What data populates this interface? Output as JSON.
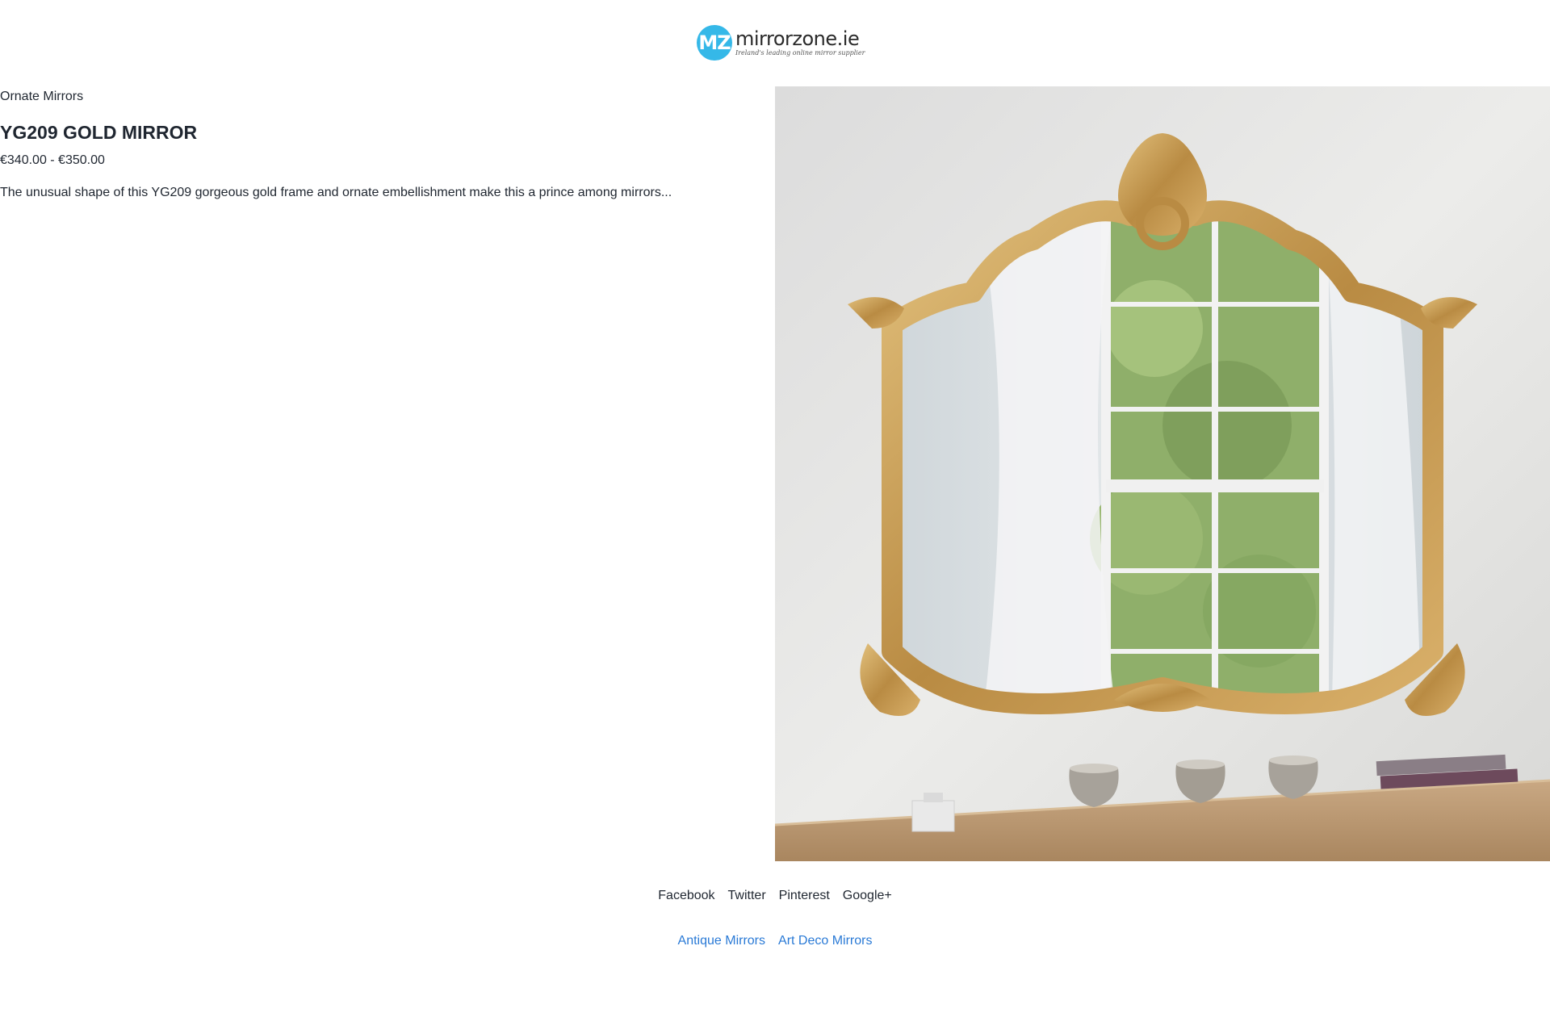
{
  "logo": {
    "badge": "MZ",
    "name": "mirrorzone.ie",
    "tagline": "Ireland's leading online mirror supplier"
  },
  "product": {
    "category": "Ornate Mirrors",
    "title": "YG209 GOLD MIRROR",
    "price": "€340.00 - €350.00",
    "description": "The unusual shape of this YG209 gorgeous gold frame and ornate embellishment make this a prince among mirrors...",
    "image_alt": "Gold ornate mirror above a wooden mantel"
  },
  "social": [
    "Facebook",
    "Twitter",
    "Pinterest",
    "Google+"
  ],
  "related": [
    "Antique Mirrors",
    "Art Deco Mirrors"
  ],
  "colors": {
    "brand": "#35b8e8",
    "link": "#2a7ad6",
    "gold": "#c9a15a",
    "text": "#1f2630"
  }
}
